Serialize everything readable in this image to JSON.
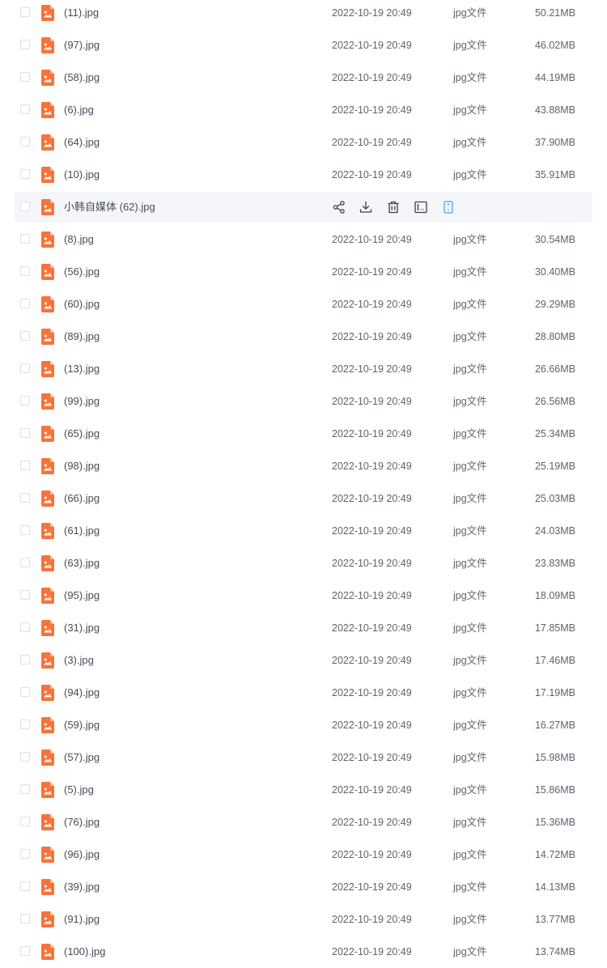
{
  "colors": {
    "file_icon": "#f7733a",
    "hover_bg": "#f5f6fa",
    "action_icon": "#3a3f4a",
    "action_active": "#4a9ff5"
  },
  "hover_actions": {
    "share_icon": "share-icon",
    "download_icon": "download-icon",
    "delete_icon": "trash-icon",
    "rename_icon": "rename-icon",
    "more_icon": "mobile-icon"
  },
  "files": [
    {
      "name": "(11).jpg",
      "date": "2022-10-19 20:49",
      "type": "jpg文件",
      "size": "50.21MB",
      "hover": false
    },
    {
      "name": "(97).jpg",
      "date": "2022-10-19 20:49",
      "type": "jpg文件",
      "size": "46.02MB",
      "hover": false
    },
    {
      "name": "(58).jpg",
      "date": "2022-10-19 20:49",
      "type": "jpg文件",
      "size": "44.19MB",
      "hover": false
    },
    {
      "name": "(6).jpg",
      "date": "2022-10-19 20:49",
      "type": "jpg文件",
      "size": "43.88MB",
      "hover": false
    },
    {
      "name": "(64).jpg",
      "date": "2022-10-19 20:49",
      "type": "jpg文件",
      "size": "37.90MB",
      "hover": false
    },
    {
      "name": "(10).jpg",
      "date": "2022-10-19 20:49",
      "type": "jpg文件",
      "size": "35.91MB",
      "hover": false
    },
    {
      "name": "小韩自媒体 (62).jpg",
      "date": "",
      "type": "",
      "size": "",
      "hover": true
    },
    {
      "name": "(8).jpg",
      "date": "2022-10-19 20:49",
      "type": "jpg文件",
      "size": "30.54MB",
      "hover": false
    },
    {
      "name": "(56).jpg",
      "date": "2022-10-19 20:49",
      "type": "jpg文件",
      "size": "30.40MB",
      "hover": false
    },
    {
      "name": "(60).jpg",
      "date": "2022-10-19 20:49",
      "type": "jpg文件",
      "size": "29.29MB",
      "hover": false
    },
    {
      "name": "(89).jpg",
      "date": "2022-10-19 20:49",
      "type": "jpg文件",
      "size": "28.80MB",
      "hover": false
    },
    {
      "name": "(13).jpg",
      "date": "2022-10-19 20:49",
      "type": "jpg文件",
      "size": "26.66MB",
      "hover": false
    },
    {
      "name": "(99).jpg",
      "date": "2022-10-19 20:49",
      "type": "jpg文件",
      "size": "26.56MB",
      "hover": false
    },
    {
      "name": "(65).jpg",
      "date": "2022-10-19 20:49",
      "type": "jpg文件",
      "size": "25.34MB",
      "hover": false
    },
    {
      "name": "(98).jpg",
      "date": "2022-10-19 20:49",
      "type": "jpg文件",
      "size": "25.19MB",
      "hover": false
    },
    {
      "name": "(66).jpg",
      "date": "2022-10-19 20:49",
      "type": "jpg文件",
      "size": "25.03MB",
      "hover": false
    },
    {
      "name": "(61).jpg",
      "date": "2022-10-19 20:49",
      "type": "jpg文件",
      "size": "24.03MB",
      "hover": false
    },
    {
      "name": "(63).jpg",
      "date": "2022-10-19 20:49",
      "type": "jpg文件",
      "size": "23.83MB",
      "hover": false
    },
    {
      "name": "(95).jpg",
      "date": "2022-10-19 20:49",
      "type": "jpg文件",
      "size": "18.09MB",
      "hover": false
    },
    {
      "name": "(31).jpg",
      "date": "2022-10-19 20:49",
      "type": "jpg文件",
      "size": "17.85MB",
      "hover": false
    },
    {
      "name": "(3).jpg",
      "date": "2022-10-19 20:49",
      "type": "jpg文件",
      "size": "17.46MB",
      "hover": false
    },
    {
      "name": "(94).jpg",
      "date": "2022-10-19 20:49",
      "type": "jpg文件",
      "size": "17.19MB",
      "hover": false
    },
    {
      "name": "(59).jpg",
      "date": "2022-10-19 20:49",
      "type": "jpg文件",
      "size": "16.27MB",
      "hover": false
    },
    {
      "name": "(57).jpg",
      "date": "2022-10-19 20:49",
      "type": "jpg文件",
      "size": "15.98MB",
      "hover": false
    },
    {
      "name": "(5).jpg",
      "date": "2022-10-19 20:49",
      "type": "jpg文件",
      "size": "15.86MB",
      "hover": false
    },
    {
      "name": "(76).jpg",
      "date": "2022-10-19 20:49",
      "type": "jpg文件",
      "size": "15.36MB",
      "hover": false
    },
    {
      "name": "(96).jpg",
      "date": "2022-10-19 20:49",
      "type": "jpg文件",
      "size": "14.72MB",
      "hover": false
    },
    {
      "name": "(39).jpg",
      "date": "2022-10-19 20:49",
      "type": "jpg文件",
      "size": "14.13MB",
      "hover": false
    },
    {
      "name": "(91).jpg",
      "date": "2022-10-19 20:49",
      "type": "jpg文件",
      "size": "13.77MB",
      "hover": false
    },
    {
      "name": "(100).jpg",
      "date": "2022-10-19 20:49",
      "type": "jpg文件",
      "size": "13.74MB",
      "hover": false
    }
  ]
}
